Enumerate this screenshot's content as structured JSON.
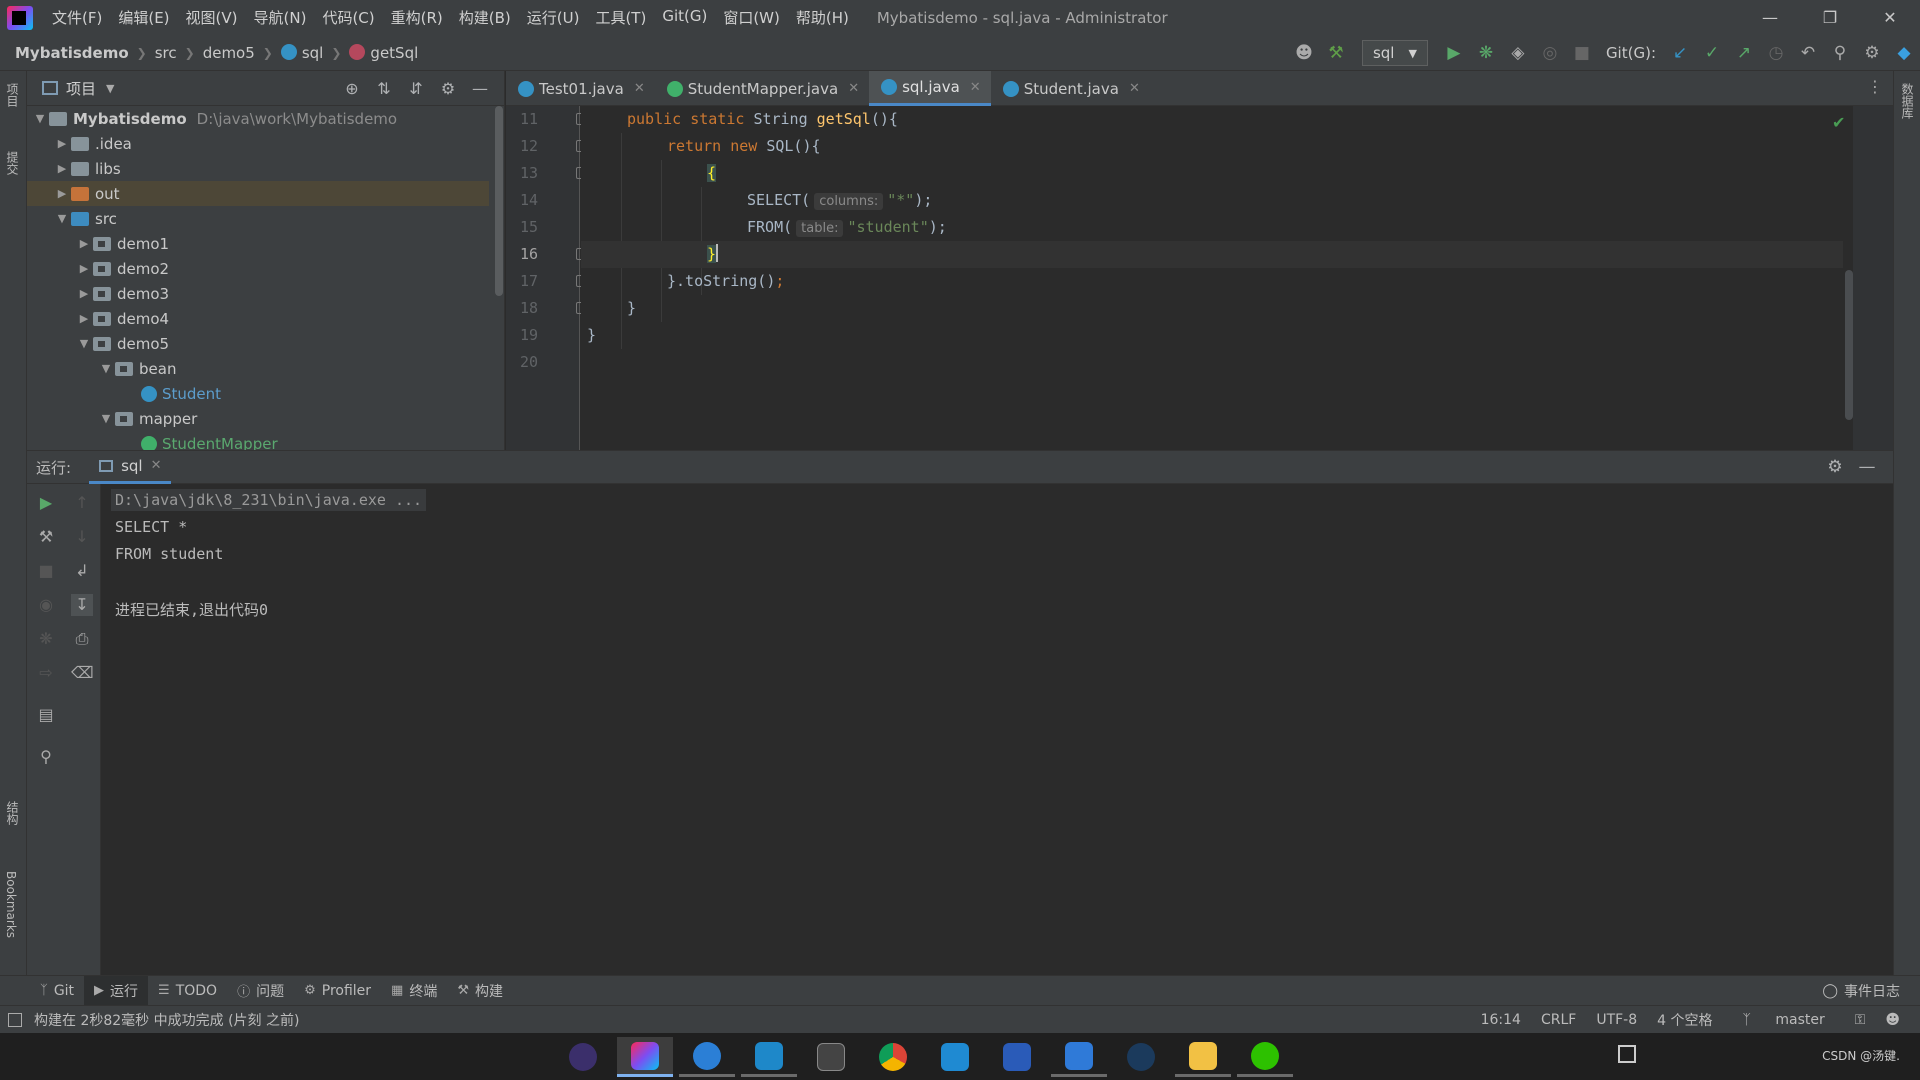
{
  "menubar": {
    "items": [
      "文件(F)",
      "编辑(E)",
      "视图(V)",
      "导航(N)",
      "代码(C)",
      "重构(R)",
      "构建(B)",
      "运行(U)",
      "工具(T)",
      "Git(G)",
      "窗口(W)",
      "帮助(H)"
    ],
    "title": "Mybatisdemo - sql.java - Administrator"
  },
  "navbar": {
    "crumbs": [
      "Mybatisdemo",
      "src",
      "demo5",
      "sql",
      "getSql"
    ],
    "run_config": "sql",
    "git_label": "Git(G):"
  },
  "project": {
    "title": "项目",
    "root": {
      "name": "Mybatisdemo",
      "path": "D:\\java\\work\\Mybatisdemo"
    },
    "items": [
      ".idea",
      "libs",
      "out",
      "src",
      "demo1",
      "demo2",
      "demo3",
      "demo4",
      "demo5",
      "bean",
      "Student",
      "mapper",
      "StudentMapper"
    ]
  },
  "editor": {
    "tabs": [
      "Test01.java",
      "StudentMapper.java",
      "sql.java",
      "Student.java"
    ],
    "active_tab": 2,
    "line_numbers": [
      "11",
      "12",
      "13",
      "14",
      "15",
      "16",
      "17",
      "18",
      "19",
      "20"
    ],
    "current_line": "16",
    "code": {
      "l11_kw1": "public static ",
      "l11_type": "String ",
      "l11_fn": "getSql",
      "l11_rest": "(){",
      "l12_kw": "return new ",
      "l12_rest": "SQL(){",
      "l13": "{",
      "l14_a": "SELECT(",
      "l14_hint": "columns:",
      "l14_str": "\"*\"",
      "l14_end": ");",
      "l15_a": "FROM(",
      "l15_hint": "table:",
      "l15_str": "\"student\"",
      "l15_end": ");",
      "l16": "}",
      "l17_a": "}.toString()",
      "l17_end": ";",
      "l18": "}",
      "l19": "}"
    }
  },
  "run": {
    "label": "运行:",
    "tab": "sql",
    "output": [
      "D:\\java\\jdk\\8_231\\bin\\java.exe ...",
      "SELECT *",
      "FROM student",
      "",
      "进程已结束,退出代码0"
    ]
  },
  "toolwindows": {
    "items": [
      "Git",
      "运行",
      "TODO",
      "问题",
      "Profiler",
      "终端",
      "构建"
    ],
    "event_log": "事件日志"
  },
  "left_stripe": [
    "项目",
    "提交",
    "结构",
    "Bookmarks"
  ],
  "right_stripe": "数据库",
  "status": {
    "message": "构建在 2秒82毫秒 中成功完成 (片刻 之前)",
    "position": "16:14",
    "line_sep": "CRLF",
    "encoding": "UTF-8",
    "indent": "4 个空格",
    "branch": "master"
  },
  "taskbar": {
    "tray_text": "CSDN @汤键."
  }
}
